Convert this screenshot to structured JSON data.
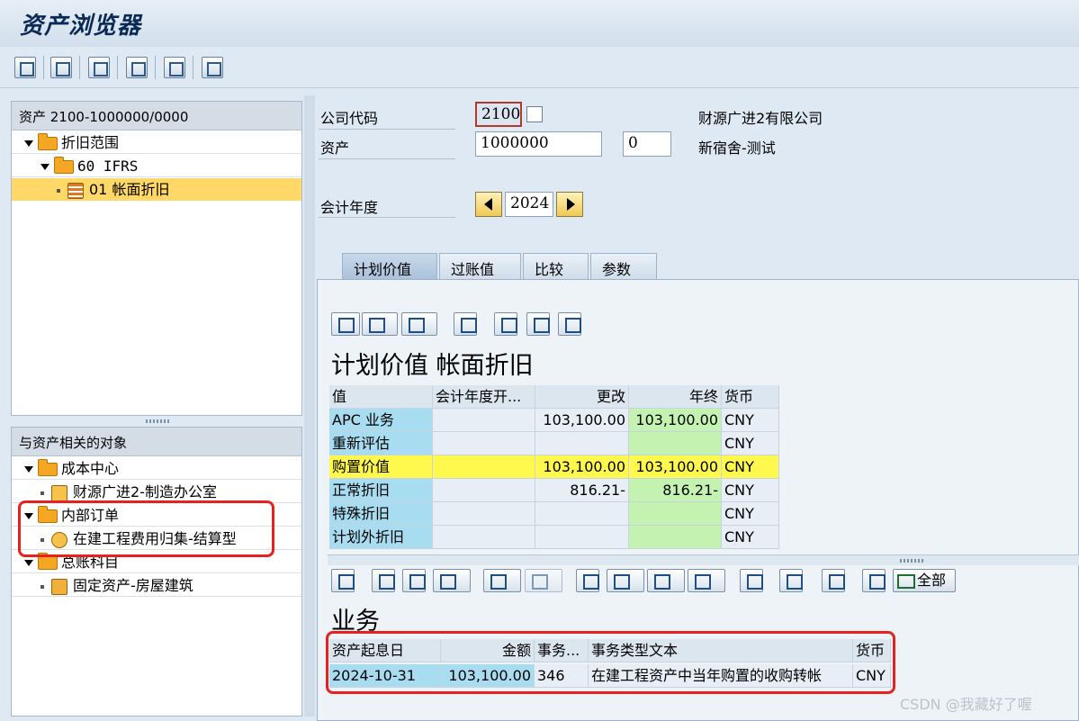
{
  "app": {
    "title": "资产浏览器"
  },
  "tree_panel": {
    "header": "资产 2100-1000000/0000",
    "nodes": [
      {
        "label": "折旧范围"
      },
      {
        "label": "60 IFRS"
      },
      {
        "label": "01 帐面折旧"
      }
    ]
  },
  "related_panel": {
    "header": "与资产相关的对象",
    "nodes": [
      {
        "label": "成本中心"
      },
      {
        "label": "财源广进2-制造办公室"
      },
      {
        "label": "内部订单"
      },
      {
        "label": "在建工程费用归集-结算型"
      },
      {
        "label": "总账科目"
      },
      {
        "label": "固定资产-房屋建筑"
      }
    ]
  },
  "form": {
    "company_code_label": "公司代码",
    "company_code_value": "2100",
    "company_name": "财源广进2有限公司",
    "asset_label": "资产",
    "asset_value": "1000000",
    "subnumber_value": "0",
    "asset_description": "新宿舍-测试",
    "fiscal_year_label": "会计年度",
    "fiscal_year_value": "2024"
  },
  "tabs": [
    {
      "label": "计划价值"
    },
    {
      "label": "过账值"
    },
    {
      "label": "比较"
    },
    {
      "label": "参数"
    }
  ],
  "values_table": {
    "title": "计划价值 帐面折旧",
    "columns": [
      "值",
      "会计年度开...",
      "更改",
      "年终",
      "货币"
    ],
    "rows": [
      [
        "APC 业务",
        "",
        "103,100.00",
        "103,100.00",
        "CNY"
      ],
      [
        "重新评估",
        "",
        "",
        "",
        "CNY"
      ],
      [
        "购置价值",
        "",
        "103,100.00",
        "103,100.00",
        "CNY"
      ],
      [
        "正常折旧",
        "",
        "816.21-",
        "816.21-",
        "CNY"
      ],
      [
        "特殊折旧",
        "",
        "",
        "",
        "CNY"
      ],
      [
        "计划外折旧",
        "",
        "",
        "",
        "CNY"
      ]
    ]
  },
  "transactions_table": {
    "title": "业务",
    "all_button_label": "全部",
    "columns": [
      "资产起息日",
      "金额",
      "事务...",
      "事务类型文本",
      "货币"
    ],
    "rows": [
      [
        "2024-10-31",
        "103,100.00",
        "346",
        "在建工程资产中当年购置的收购转帐",
        "CNY"
      ]
    ]
  },
  "watermark": "CSDN @我藏好了喔",
  "colors": {
    "highlight_red": "#e8211f",
    "selected_row": "#ffd867",
    "asset_blue": "#a8dcf0",
    "acq_yellow": "#fff94d",
    "year_end_green": "#c4f3b1"
  }
}
